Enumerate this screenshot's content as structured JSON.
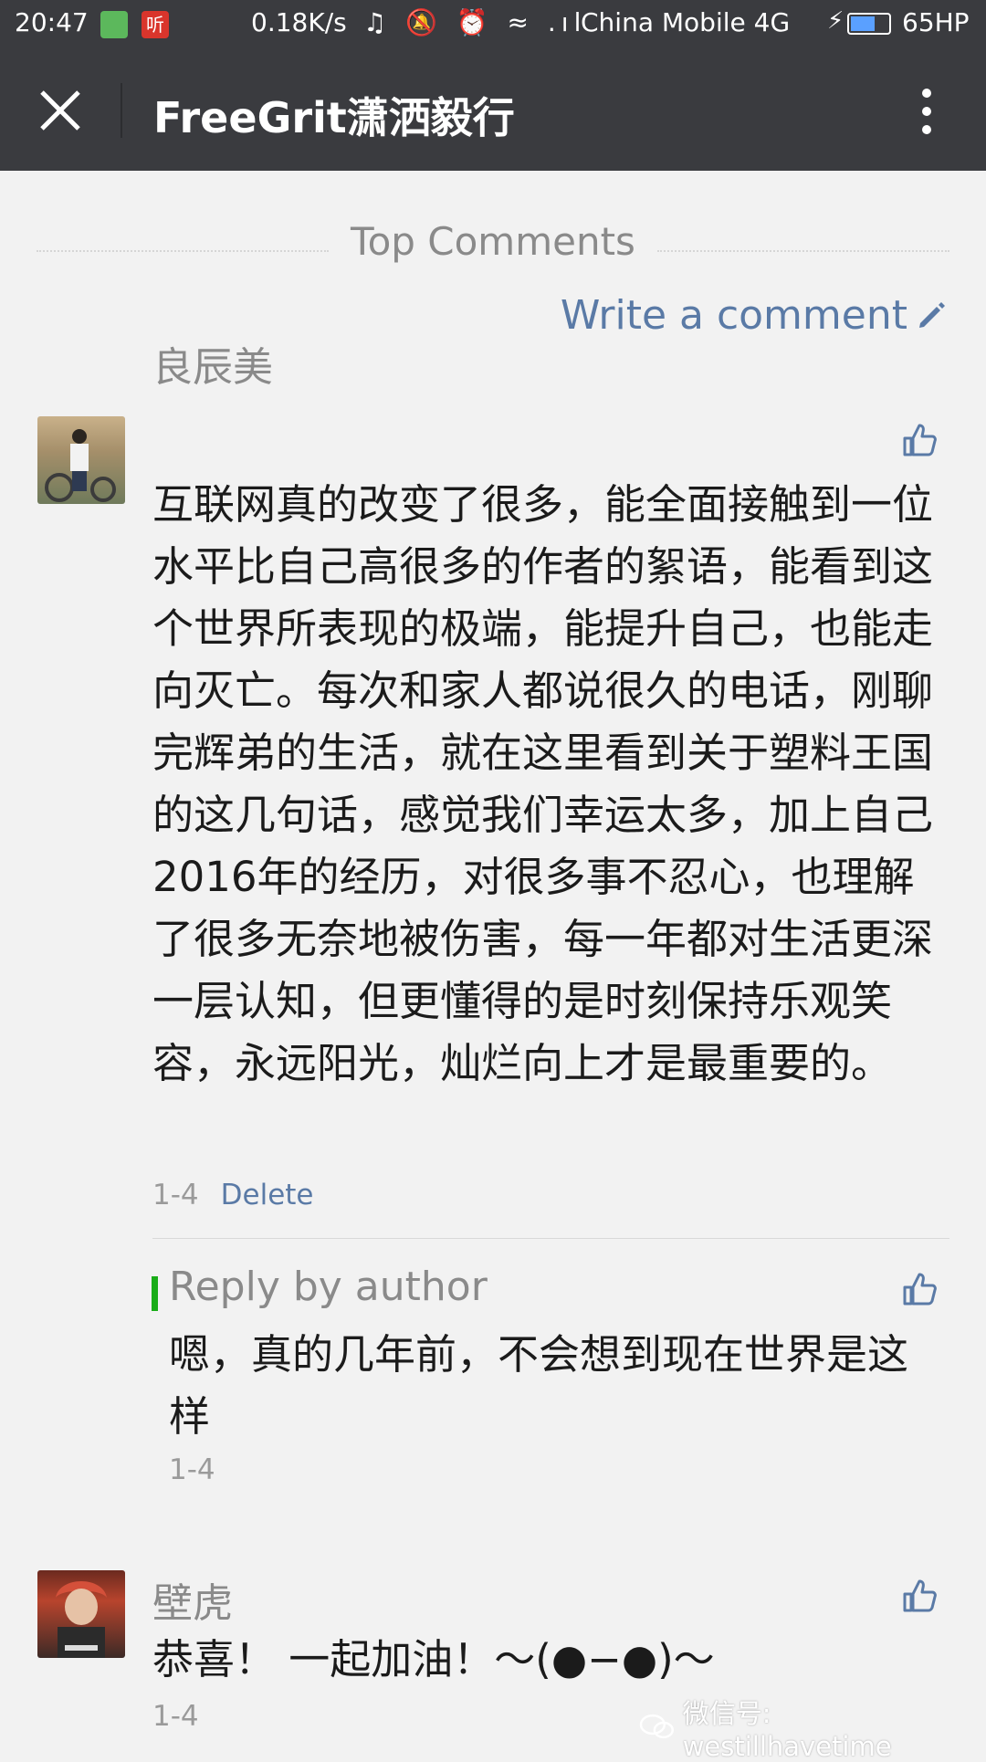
{
  "status_bar": {
    "time": "20:47",
    "notif_icon": "听",
    "speed": "0.18K/s",
    "sys_icons": "♫ 🔕 ⏰ ≈ .ıl",
    "carrier": "China Mobile 4G",
    "bolt": "⚡",
    "battery_percent": 65,
    "battery_label": "65HP"
  },
  "header": {
    "title": "FreeGrit潇洒毅行"
  },
  "section": {
    "label": "Top Comments",
    "write_comment": "Write a comment"
  },
  "comments": [
    {
      "author": "良辰美",
      "text": "互联网真的改变了很多，能全面接触到一位水平比自己高很多的作者的絮语，能看到这个世界所表现的极端，能提升自己，也能走向灭亡。每次和家人都说很久的电话，刚聊完辉弟的生活，就在这里看到关于塑料王国 的这几句话，感觉我们幸运太多，加上自己2016年的经历，对很多事不忍心，也理解了很多无奈地被伤害，每一年都对生活更深一层认知，但更懂得的是时刻保持乐观笑容，永远阳光，灿烂向上才是最重要的。",
      "date": "1-4",
      "delete_label": "Delete",
      "reply": {
        "label": "Reply by author",
        "text": "嗯，真的几年前，不会想到现在世界是这样",
        "date": "1-4"
      }
    },
    {
      "author": "壁虎",
      "text": "恭喜！ 一起加油！～(●−●)～",
      "date": "1-4"
    }
  ],
  "watermark": "微信号: westillhavetime",
  "colors": {
    "header_bg": "#3a3b3f",
    "link": "#5a7aa6",
    "reply_accent": "#1aad19",
    "page_bg": "#f2f2f2"
  }
}
